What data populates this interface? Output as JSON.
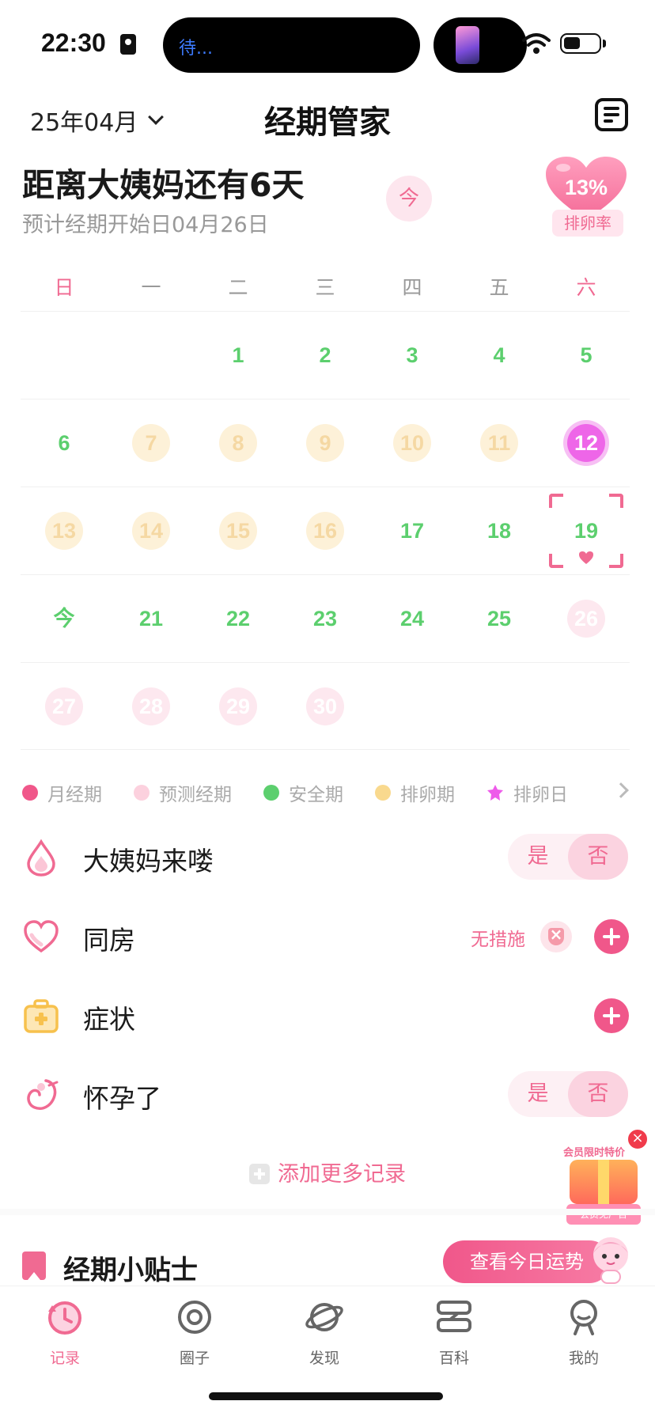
{
  "status_bar": {
    "time": "22:30",
    "island_text": "待..."
  },
  "header": {
    "month": "25年04月",
    "title": "经期管家"
  },
  "countdown": {
    "title": "距离大姨妈还有6天",
    "subtitle": "预计经期开始日04月26日",
    "today_label": "今"
  },
  "ovulation": {
    "percent": "13%",
    "label": "排卵率"
  },
  "weekdays": [
    "日",
    "一",
    "二",
    "三",
    "四",
    "五",
    "六"
  ],
  "calendar": {
    "rows": [
      [
        {
          "t": ""
        },
        {
          "t": ""
        },
        {
          "t": "1",
          "s": "safe"
        },
        {
          "t": "2",
          "s": "safe"
        },
        {
          "t": "3",
          "s": "safe"
        },
        {
          "t": "4",
          "s": "safe"
        },
        {
          "t": "5",
          "s": "safe"
        }
      ],
      [
        {
          "t": "6",
          "s": "safe"
        },
        {
          "t": "7",
          "s": "fertile"
        },
        {
          "t": "8",
          "s": "fertile"
        },
        {
          "t": "9",
          "s": "fertile"
        },
        {
          "t": "10",
          "s": "fertile"
        },
        {
          "t": "11",
          "s": "fertile"
        },
        {
          "t": "12",
          "s": "ovulation-day"
        }
      ],
      [
        {
          "t": "13",
          "s": "fertile"
        },
        {
          "t": "14",
          "s": "fertile"
        },
        {
          "t": "15",
          "s": "fertile"
        },
        {
          "t": "16",
          "s": "fertile"
        },
        {
          "t": "17",
          "s": "safe"
        },
        {
          "t": "18",
          "s": "safe"
        },
        {
          "t": "19",
          "s": "safe",
          "selected": true
        }
      ],
      [
        {
          "t": "今",
          "s": "today-mark"
        },
        {
          "t": "21",
          "s": "safe"
        },
        {
          "t": "22",
          "s": "safe"
        },
        {
          "t": "23",
          "s": "safe"
        },
        {
          "t": "24",
          "s": "safe"
        },
        {
          "t": "25",
          "s": "safe"
        },
        {
          "t": "26",
          "s": "predict"
        }
      ],
      [
        {
          "t": "27",
          "s": "predict"
        },
        {
          "t": "28",
          "s": "predict"
        },
        {
          "t": "29",
          "s": "predict"
        },
        {
          "t": "30",
          "s": "predict"
        },
        {
          "t": ""
        },
        {
          "t": ""
        },
        {
          "t": ""
        }
      ]
    ]
  },
  "legend": [
    {
      "label": "月经期",
      "color": "#f0578a"
    },
    {
      "label": "预测经期",
      "color": "#fcd1de"
    },
    {
      "label": "安全期",
      "color": "#5ccf6e"
    },
    {
      "label": "排卵期",
      "color": "#f9d98e"
    },
    {
      "label": "排卵日",
      "color": "#ee5bea"
    }
  ],
  "records": {
    "period": {
      "label": "大姨妈来喽",
      "yes": "是",
      "no": "否"
    },
    "intimacy": {
      "label": "同房",
      "method": "无措施"
    },
    "symptoms": {
      "label": "症状"
    },
    "pregnant": {
      "label": "怀孕了",
      "yes": "是",
      "no": "否"
    },
    "add_more": "添加更多记录"
  },
  "promo": {
    "title": "会员限时特价",
    "badge": "会员免广告"
  },
  "tips": {
    "title": "经期小贴士",
    "fortune_button": "查看今日运势"
  },
  "tabs": [
    {
      "label": "记录",
      "active": true
    },
    {
      "label": "圈子",
      "active": false
    },
    {
      "label": "发现",
      "active": false
    },
    {
      "label": "百科",
      "active": false
    },
    {
      "label": "我的",
      "active": false
    }
  ],
  "colors": {
    "accent": "#f06a92",
    "safe": "#5ccf6e",
    "fertile": "#fdf1d8",
    "predict": "#fde8ef",
    "ovulation": "#ee66e8"
  }
}
